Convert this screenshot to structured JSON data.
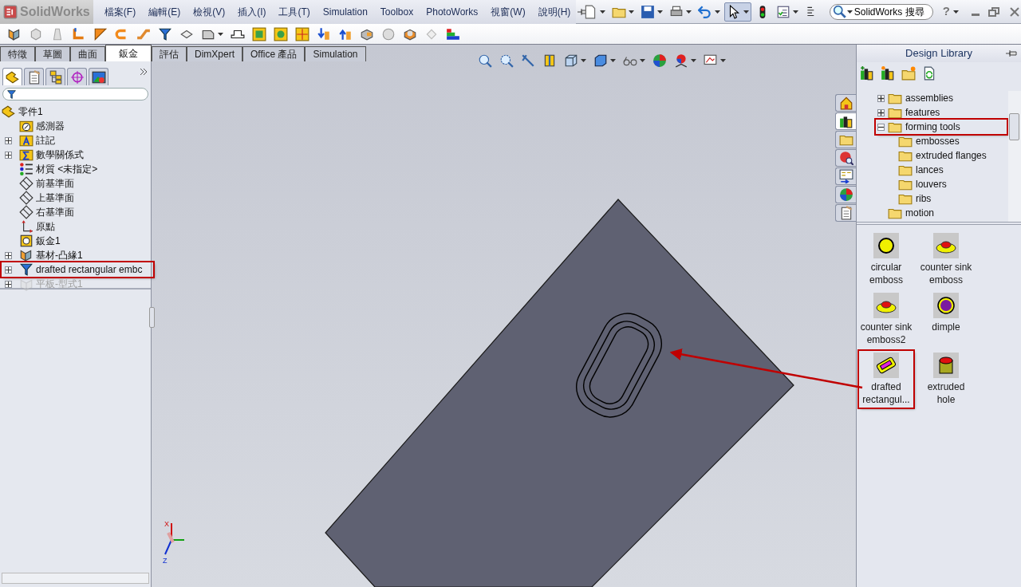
{
  "app": {
    "logo": "SolidWorks"
  },
  "menu": [
    {
      "label": "檔案(F)"
    },
    {
      "label": "編輯(E)"
    },
    {
      "label": "檢視(V)"
    },
    {
      "label": "插入(I)"
    },
    {
      "label": "工具(T)"
    },
    {
      "label": "Simulation"
    },
    {
      "label": "Toolbox"
    },
    {
      "label": "PhotoWorks"
    },
    {
      "label": "視窗(W)"
    },
    {
      "label": "說明(H)"
    }
  ],
  "quick_toolbar": [
    {
      "kind": "page",
      "dropdown": true,
      "pressed": false
    },
    {
      "kind": "folder",
      "dropdown": true,
      "pressed": false
    },
    {
      "kind": "floppy-disk",
      "dropdown": true,
      "pressed": false
    },
    {
      "kind": "printer",
      "dropdown": true,
      "pressed": false
    },
    {
      "kind": "undo-arrow",
      "dropdown": true,
      "pressed": false
    },
    {
      "kind": "cursor",
      "dropdown": true,
      "pressed": true
    },
    {
      "kind": "traffic-light",
      "dropdown": false,
      "pressed": false
    },
    {
      "kind": "checklist",
      "dropdown": true,
      "pressed": false
    },
    {
      "kind": "lines",
      "dropdown": false,
      "pressed": false
    }
  ],
  "search": {
    "placeholder": "SolidWorks 搜尋"
  },
  "help": {
    "label": "?"
  },
  "command_tools": [
    {
      "kind": "folded-sheet",
      "dropdown": false
    },
    {
      "kind": "box",
      "dropdown": false
    },
    {
      "kind": "fin",
      "dropdown": false
    },
    {
      "kind": "bend",
      "dropdown": false
    },
    {
      "kind": "corner",
      "dropdown": false
    },
    {
      "kind": "hook",
      "dropdown": false
    },
    {
      "kind": "ramp",
      "dropdown": false
    },
    {
      "kind": "funnel",
      "dropdown": false
    },
    {
      "kind": "tray",
      "dropdown": false
    },
    {
      "kind": "sheet-block",
      "dropdown": true
    },
    {
      "kind": "hat",
      "dropdown": false
    },
    {
      "kind": "square",
      "dropdown": false
    },
    {
      "kind": "circle",
      "dropdown": false
    },
    {
      "kind": "grid",
      "dropdown": false
    },
    {
      "kind": "arrow-down",
      "dropdown": false
    },
    {
      "kind": "arrow-up",
      "dropdown": false
    },
    {
      "kind": "block",
      "dropdown": false
    },
    {
      "kind": "disc",
      "dropdown": false
    },
    {
      "kind": "ball-block",
      "dropdown": false
    },
    {
      "kind": "faded-block",
      "dropdown": false
    },
    {
      "kind": "gradient",
      "dropdown": false
    }
  ],
  "command_tabs": [
    {
      "label": "特徵",
      "selected": false
    },
    {
      "label": "草圖",
      "selected": false
    },
    {
      "label": "曲面",
      "selected": false
    },
    {
      "label": "鈑金",
      "selected": true
    },
    {
      "label": "評估",
      "selected": false
    },
    {
      "label": "DimXpert",
      "selected": false
    },
    {
      "label": "Office 產品",
      "selected": false
    },
    {
      "label": "Simulation",
      "selected": false
    }
  ],
  "view_toolbar": [
    {
      "kind": "zoom-fit",
      "dropdown": false
    },
    {
      "kind": "zoom-area",
      "dropdown": false
    },
    {
      "kind": "pen-arrow",
      "dropdown": false
    },
    {
      "kind": "section",
      "dropdown": false
    },
    {
      "kind": "cube-frame",
      "dropdown": true
    },
    {
      "kind": "cube",
      "dropdown": true
    },
    {
      "kind": "glasses",
      "dropdown": true
    },
    {
      "kind": "ball",
      "dropdown": false
    },
    {
      "kind": "ball-stand",
      "dropdown": true
    },
    {
      "kind": "monitor",
      "dropdown": true
    }
  ],
  "manager_tabs": [
    {
      "kind": "part",
      "selected": true
    },
    {
      "kind": "clipboard",
      "selected": false
    },
    {
      "kind": "tree-boxes",
      "selected": false
    },
    {
      "kind": "crosshair",
      "selected": false
    },
    {
      "kind": "picture",
      "selected": false
    }
  ],
  "feature_tree": {
    "root": {
      "label": "零件1",
      "kind": "part"
    },
    "items": [
      {
        "label": "感測器",
        "kind": "gauge-folder",
        "expandable": false,
        "suppressed": false,
        "highlighted": false
      },
      {
        "label": "註記",
        "kind": "letter-folder",
        "expandable": true,
        "suppressed": false,
        "highlighted": false
      },
      {
        "label": "數學關係式",
        "kind": "sigma-folder",
        "expandable": true,
        "suppressed": false,
        "highlighted": false
      },
      {
        "label": "材質 <未指定>",
        "kind": "material",
        "expandable": false,
        "suppressed": false,
        "highlighted": false
      },
      {
        "label": "前基準面",
        "kind": "plane",
        "expandable": false,
        "suppressed": false,
        "highlighted": false
      },
      {
        "label": "上基準面",
        "kind": "plane",
        "expandable": false,
        "suppressed": false,
        "highlighted": false
      },
      {
        "label": "右基準面",
        "kind": "plane",
        "expandable": false,
        "suppressed": false,
        "highlighted": false
      },
      {
        "label": "原點",
        "kind": "origin",
        "expandable": false,
        "suppressed": false,
        "highlighted": false
      },
      {
        "label": "鈑金1",
        "kind": "sheet-metal",
        "expandable": false,
        "suppressed": false,
        "highlighted": false
      },
      {
        "label": "基材-凸緣1",
        "kind": "folded-sheet",
        "expandable": true,
        "suppressed": false,
        "highlighted": false
      },
      {
        "label": "drafted rectangular embc",
        "kind": "funnel",
        "expandable": true,
        "suppressed": false,
        "highlighted": true
      },
      {
        "label": "平板-型式1",
        "kind": "flat",
        "expandable": true,
        "suppressed": true,
        "highlighted": false
      }
    ]
  },
  "triad": {
    "labels": [
      "X",
      "Z"
    ]
  },
  "library_tabs": [
    {
      "kind": "house",
      "selected": false
    },
    {
      "kind": "books",
      "selected": true
    },
    {
      "kind": "folder",
      "selected": false
    },
    {
      "kind": "globe-search",
      "selected": false
    },
    {
      "kind": "form",
      "selected": false
    },
    {
      "kind": "ball",
      "selected": false
    },
    {
      "kind": "clipboard",
      "selected": false
    }
  ],
  "design_library": {
    "title": "Design Library",
    "tools": [
      {
        "kind": "books-plus"
      },
      {
        "kind": "books-star"
      },
      {
        "kind": "folder-star"
      },
      {
        "kind": "refresh"
      }
    ],
    "tree": [
      {
        "label": "assemblies",
        "expandable": true,
        "expanded": false,
        "highlighted": false
      },
      {
        "label": "features",
        "expandable": true,
        "expanded": false,
        "highlighted": false
      },
      {
        "label": "forming tools",
        "expandable": true,
        "expanded": true,
        "highlighted": true,
        "children": [
          {
            "label": "embosses"
          },
          {
            "label": "extruded flanges"
          },
          {
            "label": "lances"
          },
          {
            "label": "louvers"
          },
          {
            "label": "ribs"
          }
        ]
      },
      {
        "label": "motion",
        "expandable": false,
        "highlighted": false
      }
    ],
    "items": [
      {
        "label": "circular emboss",
        "kind": "disc",
        "highlighted": false
      },
      {
        "label": "counter sink emboss",
        "kind": "countersink",
        "highlighted": false
      },
      {
        "label": "counter sink emboss2",
        "kind": "countersink",
        "highlighted": false
      },
      {
        "label": "dimple",
        "kind": "dimple",
        "highlighted": false
      },
      {
        "label": "drafted rectangul...",
        "kind": "rect-emboss",
        "highlighted": true
      },
      {
        "label": "extruded hole",
        "kind": "cylinder",
        "highlighted": false
      }
    ]
  }
}
